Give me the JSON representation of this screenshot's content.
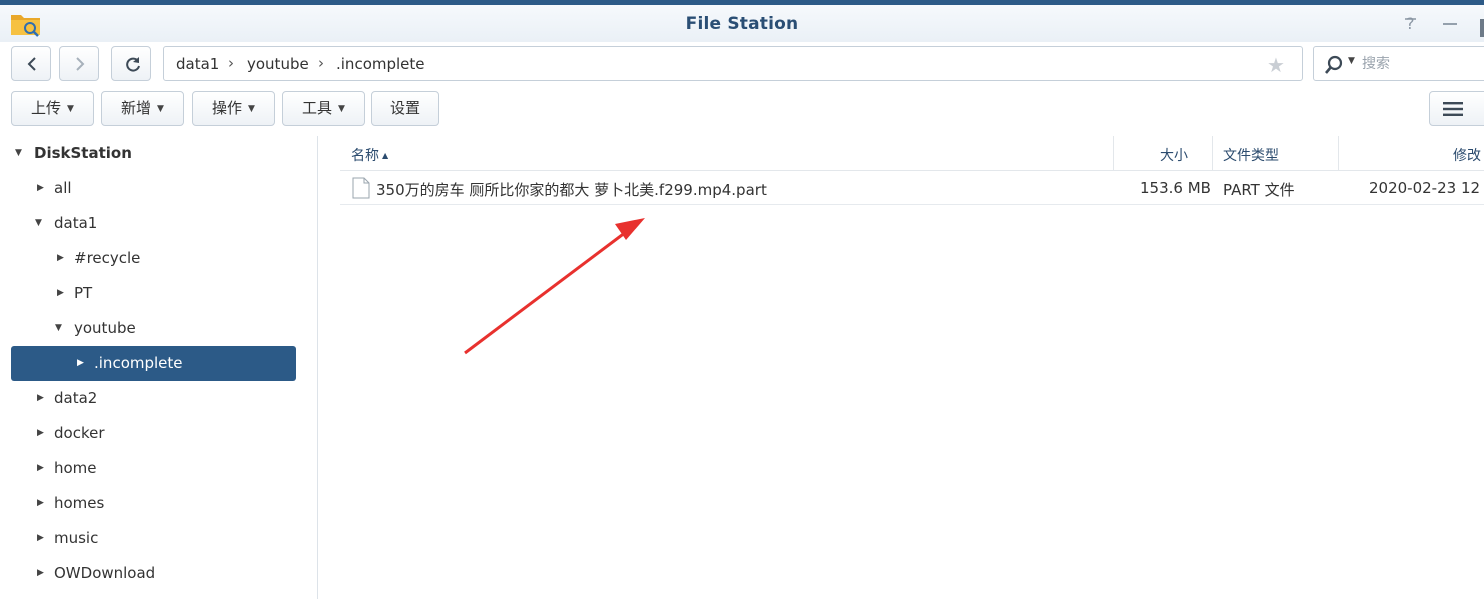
{
  "window": {
    "title": "File Station",
    "accent_color": "#2c5a87",
    "help_icon": "help-icon",
    "minimize_icon": "minimize-icon"
  },
  "nav": {
    "back_icon": "chevron-left-icon",
    "forward_icon": "chevron-right-icon",
    "refresh_icon": "refresh-icon"
  },
  "path": {
    "crumbs": [
      "data1",
      "youtube",
      ".incomplete"
    ],
    "favorite_icon": "star-icon"
  },
  "search": {
    "placeholder": "搜索"
  },
  "toolbar": {
    "upload": "上传",
    "new": "新增",
    "action": "操作",
    "tools": "工具",
    "settings": "设置",
    "view_icon": "list-view-icon"
  },
  "sidebar": {
    "root": "DiskStation",
    "items": [
      {
        "label": "all",
        "expanded": false
      },
      {
        "label": "data1",
        "expanded": true
      },
      {
        "label": "#recycle",
        "expanded": false
      },
      {
        "label": "PT",
        "expanded": false
      },
      {
        "label": "youtube",
        "expanded": true
      },
      {
        "label": ".incomplete",
        "expanded": false,
        "selected": true
      },
      {
        "label": "data2",
        "expanded": false
      },
      {
        "label": "docker",
        "expanded": false
      },
      {
        "label": "home",
        "expanded": false
      },
      {
        "label": "homes",
        "expanded": false
      },
      {
        "label": "music",
        "expanded": false
      },
      {
        "label": "OWDownload",
        "expanded": false
      }
    ],
    "selected_color": "#2c5a87"
  },
  "file_list": {
    "columns": [
      "名称",
      "大小",
      "文件类型",
      "修改"
    ],
    "sort_column": "名称",
    "sort_order": "ascending",
    "rows": [
      {
        "name": "350万的房车 厕所比你家的都大 萝卜北美.f299.mp4.part",
        "size": "153.6 MB",
        "type": "PART 文件",
        "modified": "2020-02-23 12"
      }
    ]
  },
  "annotation": {
    "arrow_color": "#e8312e"
  }
}
